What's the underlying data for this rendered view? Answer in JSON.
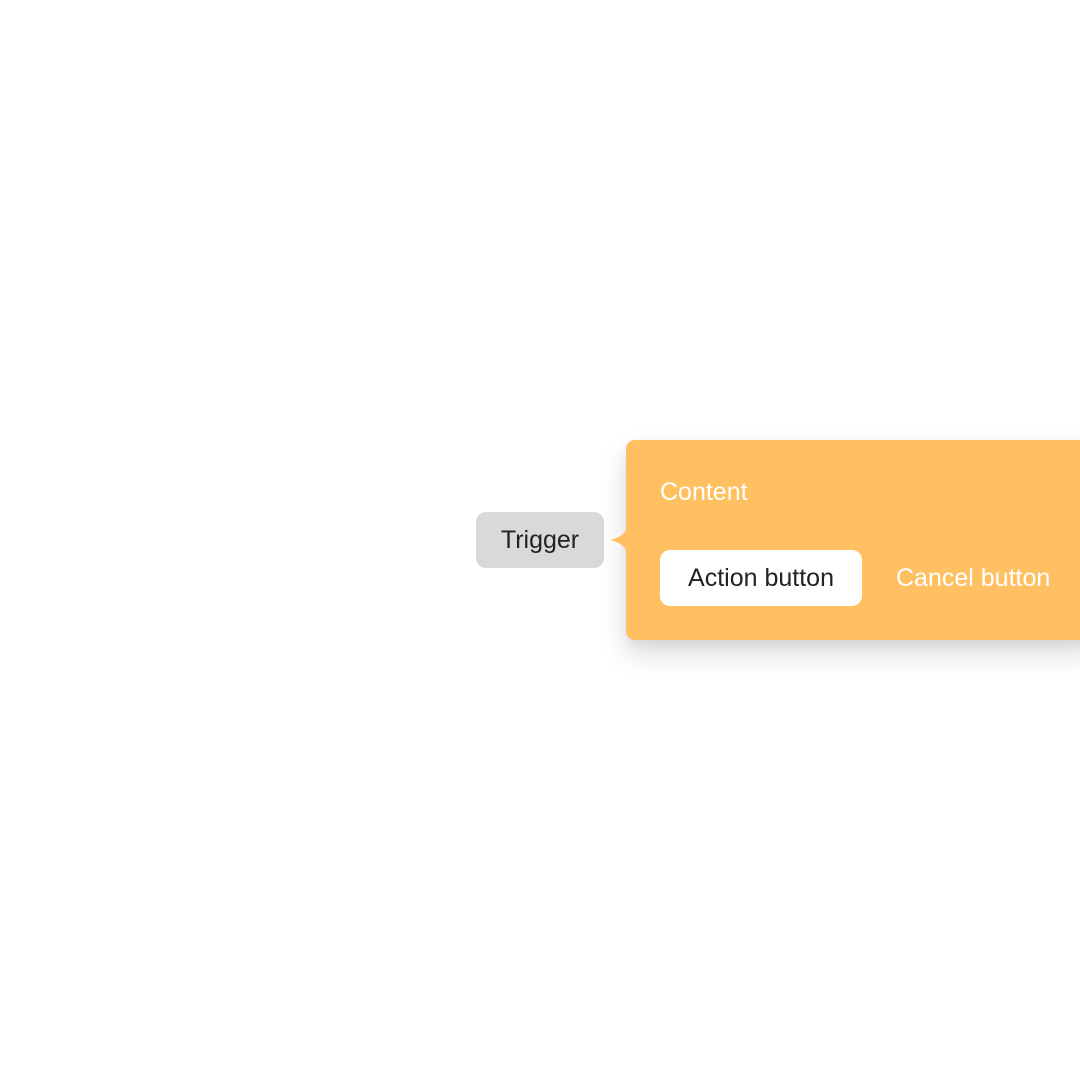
{
  "trigger": {
    "label": "Trigger"
  },
  "popover": {
    "content": "Content",
    "action_label": "Action button",
    "cancel_label": "Cancel button"
  },
  "colors": {
    "popover_background": "#ffc061",
    "trigger_background": "#d9d9d9",
    "action_background": "#ffffff",
    "text_dark": "#222222",
    "text_light": "#ffffff"
  }
}
